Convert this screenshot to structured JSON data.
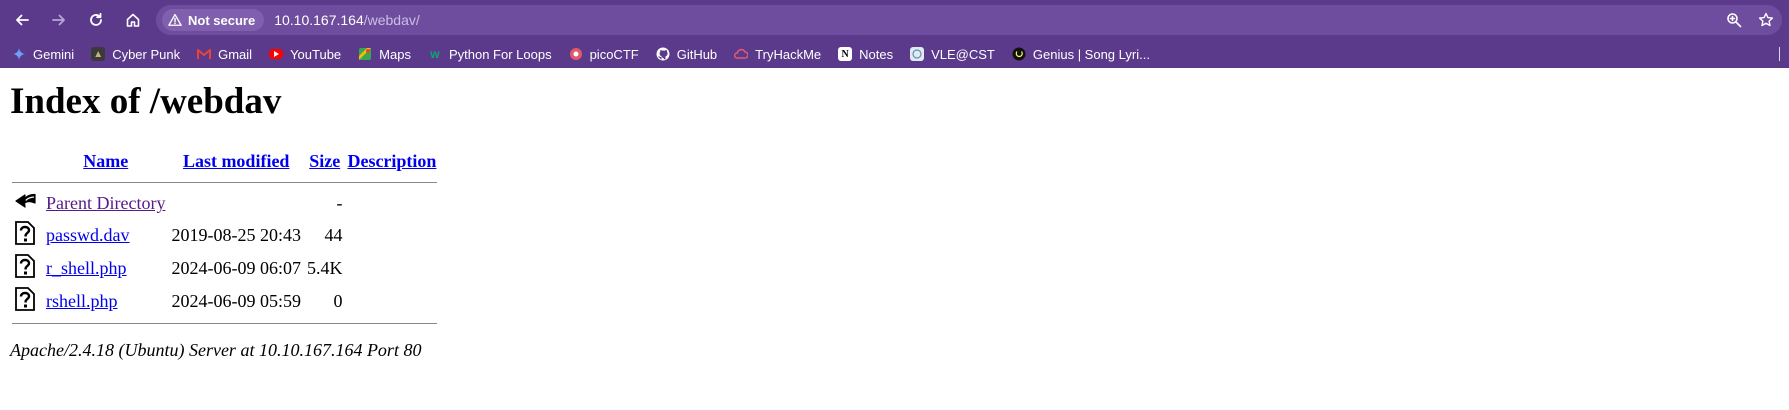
{
  "browser": {
    "security_label": "Not secure",
    "url_host": "10.10.167.164",
    "url_path": "/webdav/",
    "bookmarks": [
      {
        "label": "Gemini",
        "icon": "gemini-icon",
        "color": "#4e8cf5"
      },
      {
        "label": "Cyber Punk",
        "icon": "cyberpunk-icon",
        "color": "#c9b07a"
      },
      {
        "label": "Gmail",
        "icon": "gmail-icon",
        "color": "#ea4335"
      },
      {
        "label": "YouTube",
        "icon": "youtube-icon",
        "color": "#ff0000"
      },
      {
        "label": "Maps",
        "icon": "maps-icon",
        "color": "#34a853"
      },
      {
        "label": "Python For Loops",
        "icon": "w3schools-icon",
        "color": "#04aa6d"
      },
      {
        "label": "picoCTF",
        "icon": "picoctf-icon",
        "color": "#e05a6a"
      },
      {
        "label": "GitHub",
        "icon": "github-icon",
        "color": "#ffffff"
      },
      {
        "label": "TryHackMe",
        "icon": "tryhackme-icon",
        "color": "#d4405a"
      },
      {
        "label": "Notes",
        "icon": "notion-icon",
        "color": "#ffffff"
      },
      {
        "label": "VLE@CST",
        "icon": "vle-icon",
        "color": "#9ec7e6"
      },
      {
        "label": "Genius | Song Lyri...",
        "icon": "genius-icon",
        "color": "#000000"
      }
    ]
  },
  "page": {
    "title": "Index of /webdav",
    "columns": {
      "name": "Name",
      "last_modified": "Last modified",
      "size": "Size",
      "description": "Description"
    },
    "parent": {
      "name": "Parent Directory",
      "size": "-",
      "icon": "back-arrow-icon"
    },
    "files": [
      {
        "name": "passwd.dav",
        "modified": "2019-08-25 20:43",
        "size": "44",
        "icon": "unknown-file-icon"
      },
      {
        "name": "r_shell.php",
        "modified": "2024-06-09 06:07",
        "size": "5.4K",
        "icon": "unknown-file-icon"
      },
      {
        "name": "rshell.php",
        "modified": "2024-06-09 05:59",
        "size": "0",
        "icon": "unknown-file-icon"
      }
    ],
    "footer": "Apache/2.4.18 (Ubuntu) Server at 10.10.167.164 Port 80"
  }
}
